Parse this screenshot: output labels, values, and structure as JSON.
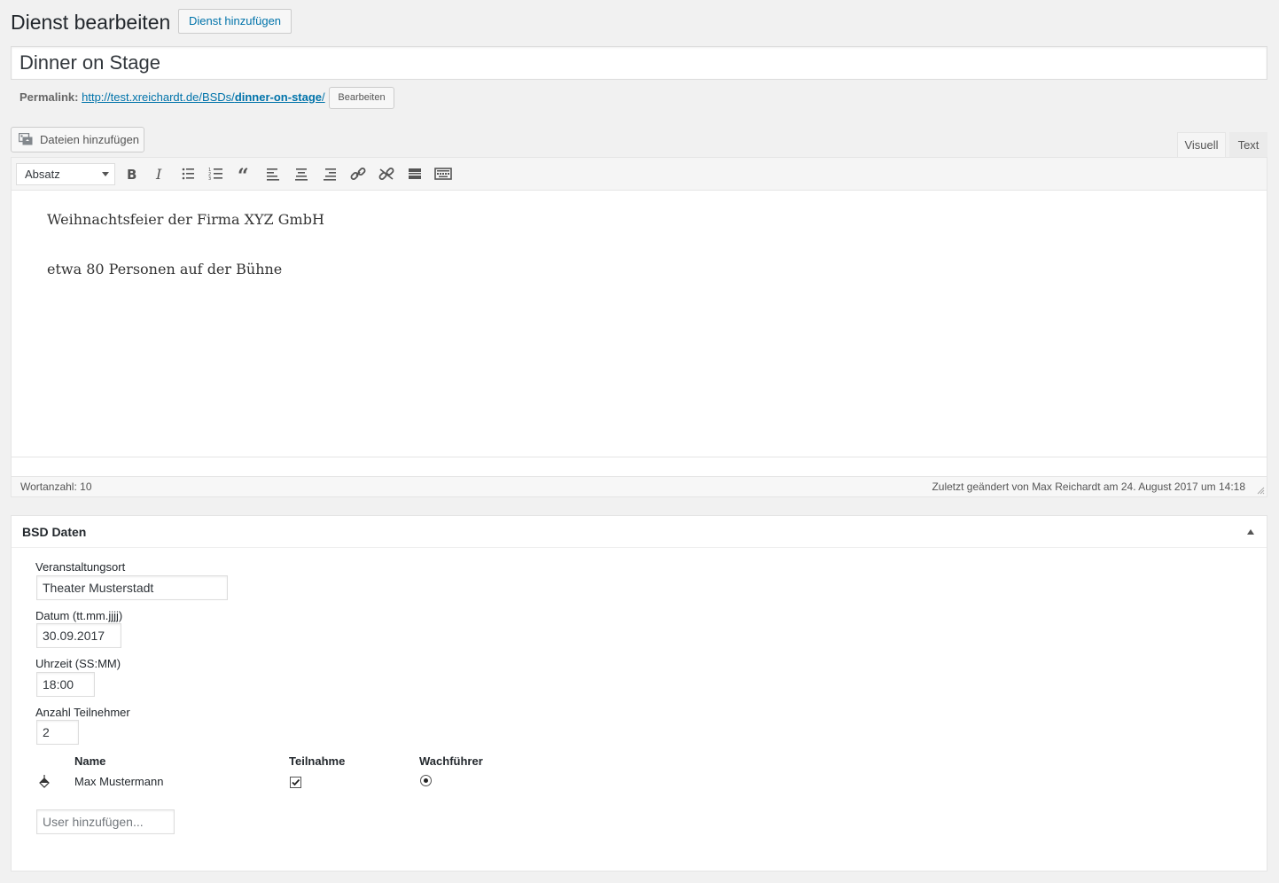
{
  "header": {
    "title": "Dienst bearbeiten",
    "add_new_label": "Dienst hinzufügen"
  },
  "post_title": "Dinner on Stage",
  "permalink": {
    "label": "Permalink:",
    "url_base": "http://test.xreichardt.de/BSDs/",
    "slug": "dinner-on-stage",
    "url_trailing": "/",
    "edit_label": "Bearbeiten"
  },
  "media": {
    "add_label": "Dateien hinzufügen",
    "icon": "add-media-icon"
  },
  "editor_tabs": {
    "visual": "Visuell",
    "text": "Text",
    "active": "Visuell"
  },
  "toolbar": {
    "format_value": "Absatz",
    "buttons": [
      "bold",
      "italic",
      "bullet-list",
      "numbered-list",
      "blockquote",
      "align-left",
      "align-center",
      "align-right",
      "insert-link",
      "remove-link",
      "read-more",
      "toolbar-toggle"
    ]
  },
  "content": {
    "paragraphs": [
      "Weihnachtsfeier der Firma XYZ GmbH",
      "etwa 80 Personen auf der Bühne"
    ]
  },
  "status": {
    "wordcount": "Wortanzahl: 10",
    "last_edit": "Zuletzt geändert von Max Reichardt am 24. August 2017 um 14:18"
  },
  "metabox": {
    "title": "BSD Daten",
    "fields": {
      "venue_label": "Veranstaltungsort",
      "venue_value": "Theater Musterstadt",
      "date_label": "Datum (tt.mm.jjjj)",
      "date_value": "30.09.2017",
      "time_label": "Uhrzeit (SS:MM)",
      "time_value": "18:00",
      "count_label": "Anzahl Teilnehmer",
      "count_value": "2"
    },
    "table": {
      "columns": [
        "Name",
        "Teilnahme",
        "Wachführer"
      ],
      "rows": [
        {
          "name": "Max Mustermann",
          "participation": true,
          "leader": true
        }
      ]
    },
    "add_user_placeholder": "User hinzufügen..."
  },
  "colors": {
    "link": "#0073aa",
    "background": "#f1f1f1",
    "border": "#e5e5e5"
  }
}
